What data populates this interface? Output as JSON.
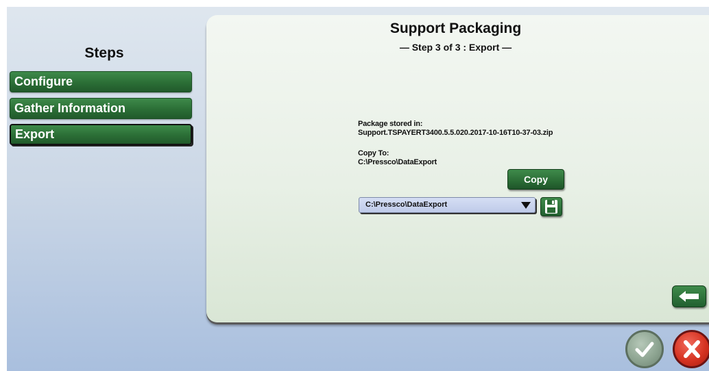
{
  "steps": {
    "title": "Steps",
    "items": [
      {
        "label": "Configure",
        "active": false
      },
      {
        "label": "Gather Information",
        "active": false
      },
      {
        "label": "Export",
        "active": true
      }
    ]
  },
  "panel": {
    "title": "Support Packaging",
    "subtitle": "— Step 3 of 3 : Export —",
    "package_label": "Package stored in:",
    "package_file": "Support.TSPAYERT3400.5.5.020.2017-10-16T10-37-03.zip",
    "copy_to_label": "Copy To:",
    "copy_to_path": "C:\\Pressco\\DataExport",
    "copy_button": "Copy",
    "destination_dropdown": {
      "selected": "C:\\Pressco\\DataExport"
    }
  },
  "icons": {
    "save": "floppy-disk-icon",
    "back": "arrow-left-icon",
    "ok": "checkmark-icon",
    "cancel": "x-icon"
  },
  "colors": {
    "button_green": "#2b6e36",
    "dropdown_blue": "#c6d1ec",
    "cancel_red": "#d63322",
    "ok_gray_green": "#8ea592"
  }
}
